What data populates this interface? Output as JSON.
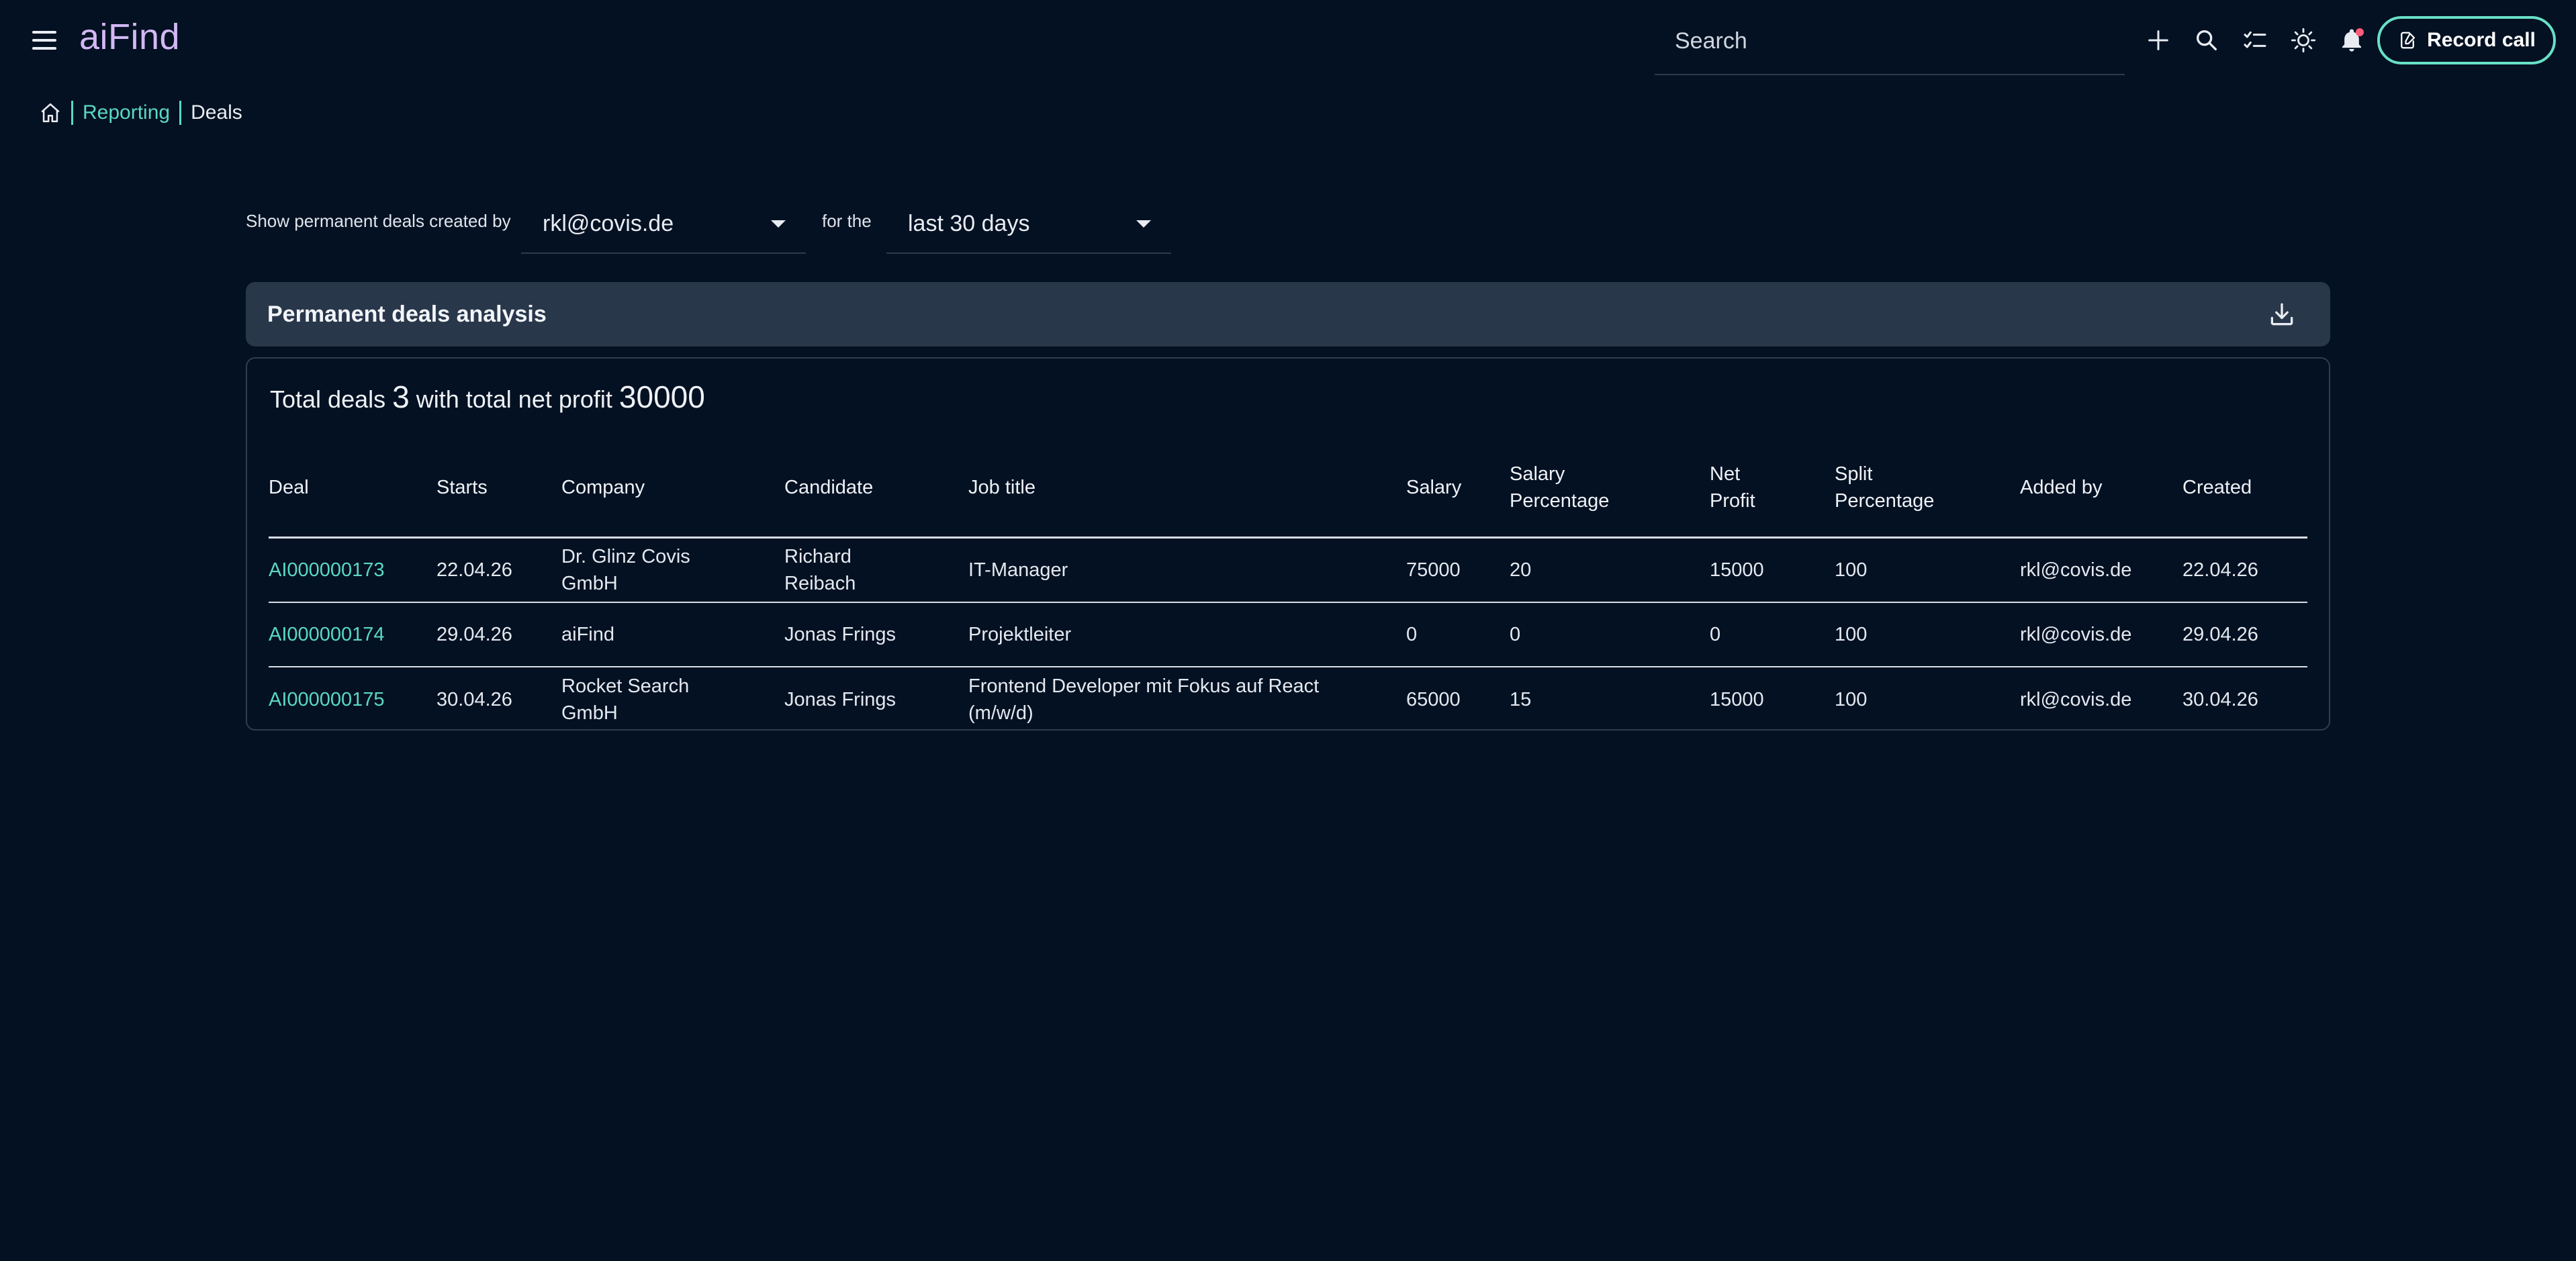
{
  "app": {
    "logo": "aiFind"
  },
  "header": {
    "search_placeholder": "Search",
    "record_call_label": "Record call",
    "icons": [
      "menu-icon",
      "plus-icon",
      "search-icon",
      "checklist-icon",
      "theme-icon",
      "bell-icon",
      "record-call-icon"
    ],
    "accent_color": "#68e0c6"
  },
  "breadcrumb": {
    "home_icon": "home-icon",
    "reporting": "Reporting",
    "current": "Deals"
  },
  "filters": {
    "created_by_label": "Show permanent deals created by",
    "created_by_value": "rkl@covis.de",
    "for_the_label": "for the",
    "period_value": "last 30 days"
  },
  "panel": {
    "title": "Permanent deals analysis",
    "download_icon": "download-icon"
  },
  "summary": {
    "prefix": "Total deals",
    "deal_count": "3",
    "middle": "with total net profit",
    "net_profit": "30000"
  },
  "table": {
    "columns": [
      [
        "Deal"
      ],
      [
        "Starts"
      ],
      [
        "Company"
      ],
      [
        "Candidate"
      ],
      [
        "Job title"
      ],
      [
        "Salary"
      ],
      [
        "Salary",
        "Percentage"
      ],
      [
        "Net",
        "Profit"
      ],
      [
        "Split",
        "Percentage"
      ],
      [
        "Added by"
      ],
      [
        "Created"
      ]
    ],
    "rows": [
      {
        "deal": "AI000000173",
        "starts": "22.04.26",
        "company": [
          "Dr. Glinz Covis",
          "GmbH"
        ],
        "candidate": [
          "Richard",
          "Reibach"
        ],
        "job_title": [
          "IT-Manager"
        ],
        "salary": "75000",
        "salary_percentage": "20",
        "net_profit": "15000",
        "split_percentage": "100",
        "added_by": "rkl@covis.de",
        "created": "22.04.26"
      },
      {
        "deal": "AI000000174",
        "starts": "29.04.26",
        "company": [
          "aiFind"
        ],
        "candidate": [
          "Jonas Frings"
        ],
        "job_title": [
          "Projektleiter"
        ],
        "salary": "0",
        "salary_percentage": "0",
        "net_profit": "0",
        "split_percentage": "100",
        "added_by": "rkl@covis.de",
        "created": "29.04.26"
      },
      {
        "deal": "AI000000175",
        "starts": "30.04.26",
        "company": [
          "Rocket Search",
          "GmbH"
        ],
        "candidate": [
          "Jonas Frings"
        ],
        "job_title": [
          "Frontend Developer mit Fokus auf React",
          "(m/w/d)"
        ],
        "salary": "65000",
        "salary_percentage": "15",
        "net_profit": "15000",
        "split_percentage": "100",
        "added_by": "rkl@covis.de",
        "created": "30.04.26"
      }
    ]
  }
}
